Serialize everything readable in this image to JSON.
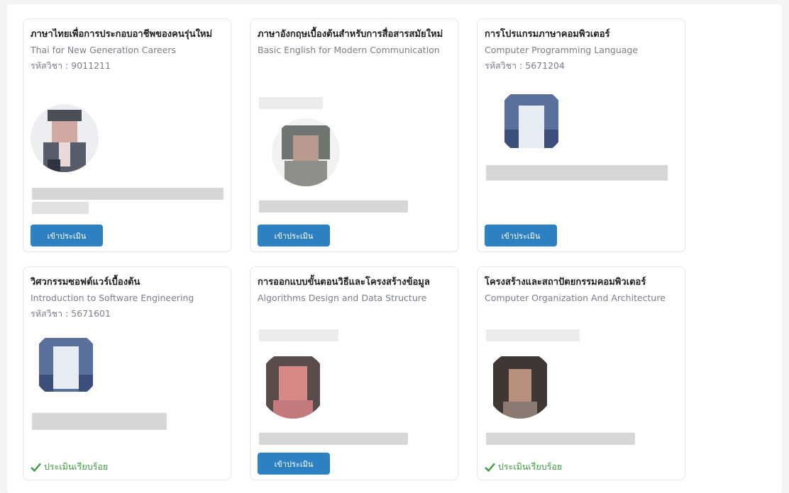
{
  "courses": [
    {
      "title_th": "ภาษาไทยเพื่อการประกอบอาชีพของคนรุ่นใหม่",
      "title_en": "Thai for New Generation Careers",
      "code": "รหัสวิชา : 9011211",
      "action": "เข้าประเมิน",
      "avatar_icon": "person-photo-icon"
    },
    {
      "title_th": "ภาษาอังกฤษเบื้องต้นสำหรับการสื่อสารสมัยใหม่",
      "title_en": "Basic English for Modern Communication",
      "code": "",
      "action": "เข้าประเมิน",
      "avatar_icon": "person-photo-icon"
    },
    {
      "title_th": "การโปรแกรมภาษาคอมพิวเตอร์",
      "title_en": "Computer Programming Language",
      "code": "รหัสวิชา : 5671204",
      "action": "เข้าประเมิน",
      "avatar_icon": "person-photo-icon"
    },
    {
      "title_th": "วิศวกรรมซอฟต์แวร์เบื้องต้น",
      "title_en": "Introduction to Software Engineering",
      "code": "รหัสวิชา : 5671601",
      "status": "ประเมินเรียบร้อย",
      "avatar_icon": "person-photo-icon"
    },
    {
      "title_th": "การออกแบบขั้นตอนวิธีและโครงสร้างข้อมูล",
      "title_en": "Algorithms Design and Data Structure",
      "code": "",
      "action": "เข้าประเมิน",
      "avatar_icon": "person-photo-icon"
    },
    {
      "title_th": "โครงสร้างและสถาปัตยกรรมคอมพิวเตอร์",
      "title_en": "Computer Organization And Architecture",
      "code": "",
      "status": "ประเมินเรียบร้อย",
      "avatar_icon": "person-photo-icon"
    }
  ],
  "colors": {
    "button": "#2d80c2",
    "success": "#3f9b41"
  }
}
